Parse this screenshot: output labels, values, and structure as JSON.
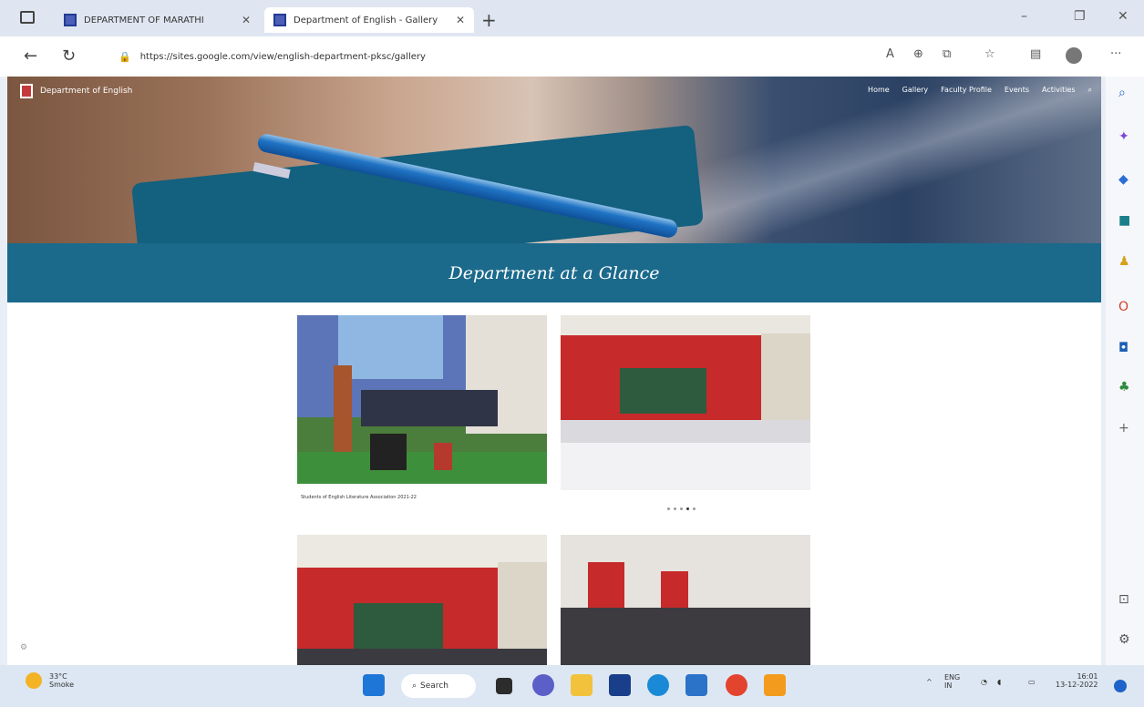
{
  "browser": {
    "tabs": [
      {
        "title": "DEPARTMENT OF MARATHI",
        "active": false
      },
      {
        "title": "Department of English - Gallery",
        "active": true
      }
    ],
    "new_tab": "+",
    "url": "https://sites.google.com/view/english-department-pksc/gallery",
    "nav": {
      "back": "←",
      "refresh": "↻"
    },
    "window": {
      "minimize": "–",
      "restore": "❐",
      "close": "✕"
    },
    "more": "···"
  },
  "site": {
    "name": "Department of English",
    "nav": [
      "Home",
      "Gallery",
      "Faculty Profile",
      "Events",
      "Activities"
    ],
    "banner_title": "Department at a Glance",
    "caption": "Students of English Literature Association 2021-22",
    "carousel_dots": 5,
    "carousel_active": 3
  },
  "sidebar_icons": [
    "search-icon",
    "copilot-icon",
    "tag-icon",
    "briefcase-icon",
    "games-icon",
    "office-icon",
    "outlook-icon",
    "tree-icon",
    "add-icon",
    "split-screen-icon",
    "settings-icon"
  ],
  "taskbar": {
    "weather_temp": "33°C",
    "weather_desc": "Smoke",
    "search_label": "Search",
    "lang": "ENG",
    "region": "IN",
    "time": "16:01",
    "date": "13-12-2022"
  },
  "colors": {
    "banner": "#1b6a8c",
    "tab_active": "#ffffff"
  }
}
